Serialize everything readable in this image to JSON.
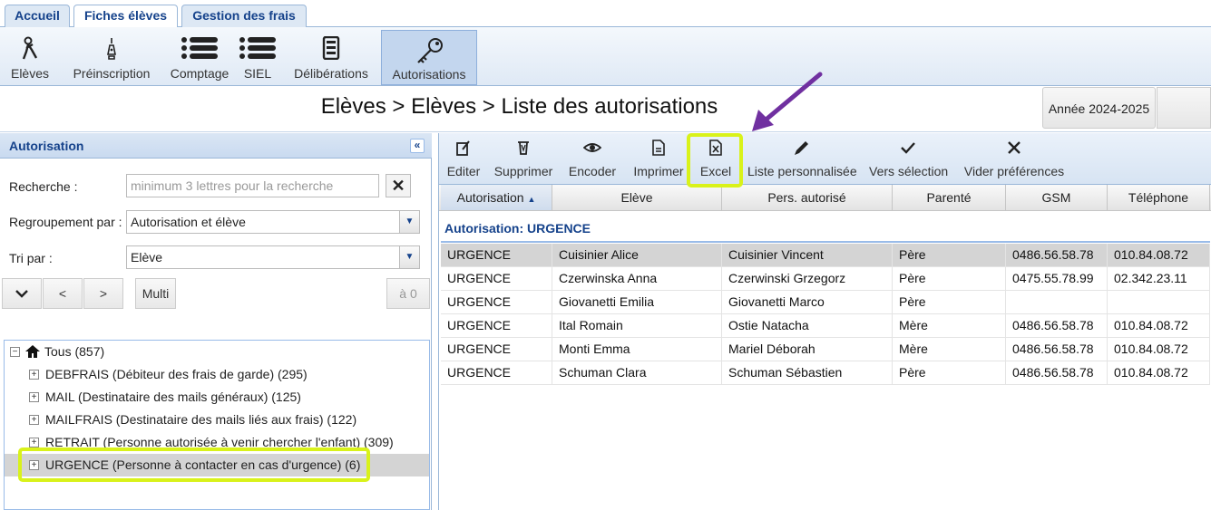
{
  "tabs": [
    {
      "label": "Accueil"
    },
    {
      "label": "Fiches élèves"
    },
    {
      "label": "Gestion des frais"
    }
  ],
  "toolbar": {
    "items": [
      {
        "label": "Elèves",
        "icon": "student-icon"
      },
      {
        "label": "Préinscription",
        "icon": "pen-nib-icon"
      },
      {
        "label": "Comptage",
        "icon": "list-icon"
      },
      {
        "label": "SIEL",
        "icon": "list-icon"
      },
      {
        "label": "Délibérations",
        "icon": "document-icon"
      },
      {
        "label": "Autorisations",
        "icon": "key-icon"
      }
    ]
  },
  "breadcrumb": "Elèves > Elèves > Liste des autorisations",
  "year_button": "Année 2024-2025",
  "left": {
    "title": "Autorisation",
    "search_label": "Recherche :",
    "search_placeholder": "minimum 3 lettres pour la recherche",
    "group_label": "Regroupement par :",
    "group_value": "Autorisation et élève",
    "sort_label": "Tri par :",
    "sort_value": "Elève",
    "prev": "<",
    "next": ">",
    "multi": "Multi",
    "a0": "à 0",
    "tree": {
      "root": "Tous (857)",
      "nodes": [
        "DEBFRAIS (Débiteur des frais de garde) (295)",
        "MAIL (Destinataire des mails généraux) (125)",
        "MAILFRAIS (Destinataire des mails liés aux frais) (122)",
        "RETRAIT (Personne autorisée à venir chercher l'enfant) (309)",
        "URGENCE (Personne à contacter en cas d'urgence) (6)"
      ]
    }
  },
  "right": {
    "actions": [
      {
        "label": "Editer",
        "icon": "edit-icon"
      },
      {
        "label": "Supprimer",
        "icon": "trash-icon"
      },
      {
        "label": "Encoder",
        "icon": "eye-icon"
      },
      {
        "label": "Imprimer",
        "icon": "pdf-icon"
      },
      {
        "label": "Excel",
        "icon": "excel-icon"
      },
      {
        "label": "Liste personnalisée",
        "icon": "pencil-icon"
      },
      {
        "label": "Vers sélection",
        "icon": "check-icon"
      },
      {
        "label": "Vider préférences",
        "icon": "x-icon"
      }
    ],
    "columns": [
      "Autorisation",
      "Elève",
      "Pers. autorisé",
      "Parenté",
      "GSM",
      "Téléphone"
    ],
    "group_title": "Autorisation: URGENCE",
    "rows": [
      [
        "URGENCE",
        "Cuisinier Alice",
        "Cuisinier Vincent",
        "Père",
        "0486.56.58.78",
        "010.84.08.72"
      ],
      [
        "URGENCE",
        "Czerwinska Anna",
        "Czerwinski Grzegorz",
        "Père",
        "0475.55.78.99",
        "02.342.23.11"
      ],
      [
        "URGENCE",
        "Giovanetti Emilia",
        "Giovanetti Marco",
        "Père",
        "",
        ""
      ],
      [
        "URGENCE",
        "Ital Romain",
        "Ostie Natacha",
        "Mère",
        "0486.56.58.78",
        "010.84.08.72"
      ],
      [
        "URGENCE",
        "Monti Emma",
        "Mariel Déborah",
        "Mère",
        "0486.56.58.78",
        "010.84.08.72"
      ],
      [
        "URGENCE",
        "Schuman Clara",
        "Schuman Sébastien",
        "Père",
        "0486.56.58.78",
        "010.84.08.72"
      ]
    ]
  },
  "colors": {
    "highlight": "#d9f21a",
    "arrow": "#7030a0",
    "header_blue": "#15428b"
  }
}
